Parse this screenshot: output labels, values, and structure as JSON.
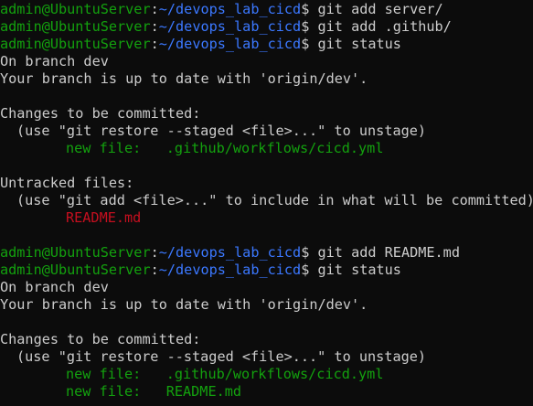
{
  "colors": {
    "background": "#0c0c0c",
    "foreground": "#cccccc",
    "prompt_user": "#13a10e",
    "prompt_path": "#3b78ff",
    "staged": "#13a10e",
    "untracked": "#c50f1f"
  },
  "prompt": {
    "user_host": "admin@UbuntuServer",
    "sep": ":",
    "path": "~/devops_lab_cicd",
    "symbol": "$"
  },
  "lines": [
    {
      "kind": "prompt",
      "command": "git add server/"
    },
    {
      "kind": "prompt",
      "command": "git add .github/"
    },
    {
      "kind": "prompt",
      "command": "git status"
    },
    {
      "kind": "text",
      "text": "On branch dev"
    },
    {
      "kind": "text",
      "text": "Your branch is up to date with 'origin/dev'."
    },
    {
      "kind": "blank",
      "text": ""
    },
    {
      "kind": "text",
      "text": "Changes to be committed:"
    },
    {
      "kind": "hint",
      "text": "(use \"git restore --staged <file>...\" to unstage)"
    },
    {
      "kind": "staged",
      "text": "new file:   .github/workflows/cicd.yml"
    },
    {
      "kind": "blank",
      "text": ""
    },
    {
      "kind": "text",
      "text": "Untracked files:"
    },
    {
      "kind": "hint",
      "text": "(use \"git add <file>...\" to include in what will be committed)"
    },
    {
      "kind": "untracked",
      "text": "README.md"
    },
    {
      "kind": "blank",
      "text": ""
    },
    {
      "kind": "prompt",
      "command": "git add README.md"
    },
    {
      "kind": "prompt",
      "command": "git status"
    },
    {
      "kind": "text",
      "text": "On branch dev"
    },
    {
      "kind": "text",
      "text": "Your branch is up to date with 'origin/dev'."
    },
    {
      "kind": "blank",
      "text": ""
    },
    {
      "kind": "text",
      "text": "Changes to be committed:"
    },
    {
      "kind": "hint",
      "text": "(use \"git restore --staged <file>...\" to unstage)"
    },
    {
      "kind": "staged",
      "text": "new file:   .github/workflows/cicd.yml"
    },
    {
      "kind": "staged",
      "text": "new file:   README.md"
    }
  ]
}
